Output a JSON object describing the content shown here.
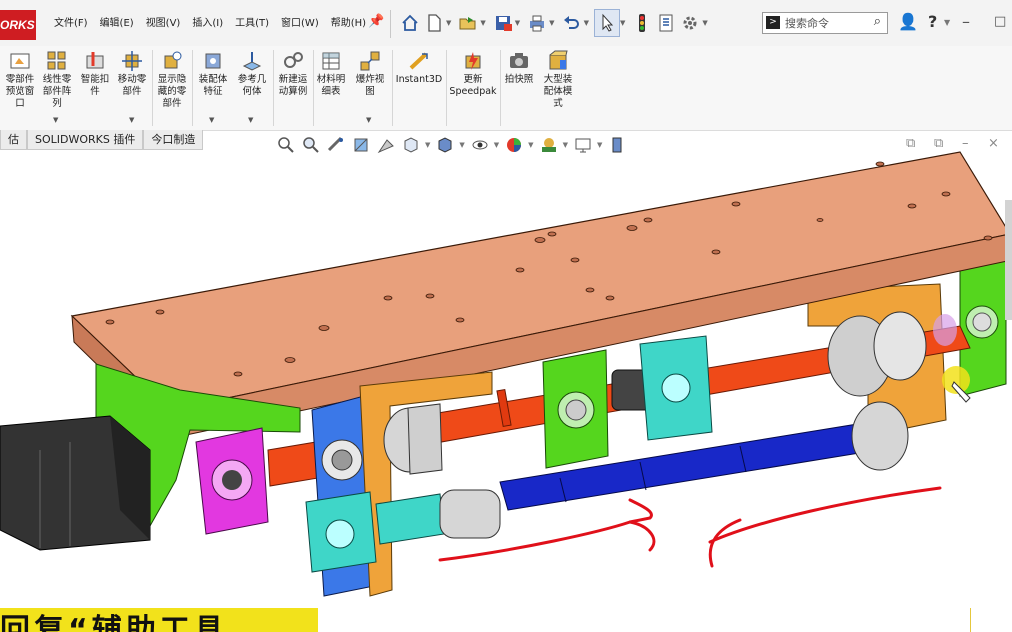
{
  "app": {
    "logo_text": "ORKS"
  },
  "menus": [
    {
      "label": "文件(F)"
    },
    {
      "label": "编辑(E)"
    },
    {
      "label": "视图(V)"
    },
    {
      "label": "插入(I)"
    },
    {
      "label": "工具(T)"
    },
    {
      "label": "窗口(W)"
    },
    {
      "label": "帮助(H)"
    }
  ],
  "search": {
    "placeholder": "搜索命令"
  },
  "ribbon": [
    {
      "label": "零部件\n预览窗\n口"
    },
    {
      "label": "线性零\n部件阵\n列"
    },
    {
      "label": "智能扣\n件"
    },
    {
      "label": "移动零\n部件"
    },
    {
      "label": "显示隐\n藏的零\n部件"
    },
    {
      "label": "装配体\n特征"
    },
    {
      "label": "参考几\n何体"
    },
    {
      "label": "新建运\n动算例"
    },
    {
      "label": "材料明\n细表"
    },
    {
      "label": "爆炸视\n图"
    },
    {
      "label": "Instant3D"
    },
    {
      "label": "更新\nSpeedpak"
    },
    {
      "label": "拍快照"
    },
    {
      "label": "大型装\n配体模\n式"
    }
  ],
  "command_tabs": [
    {
      "label": "估"
    },
    {
      "label": "SOLIDWORKS 插件"
    },
    {
      "label": "今口制造"
    }
  ],
  "caption": {
    "text": "回复“辅助工具"
  },
  "colors": {
    "plate": "#e8a07c",
    "bracket_green": "#55d61e",
    "block_orange": "#efa33a",
    "shaft_red": "#ef4a18",
    "shaft_blue": "#1828c8",
    "motor": "#333333",
    "pink_flange": "#e238e0",
    "cyan_block": "#3fd6c8",
    "blue_plate": "#3b78e8",
    "annotation_red": "#e0101a",
    "caption_yellow": "#f2e21b"
  }
}
